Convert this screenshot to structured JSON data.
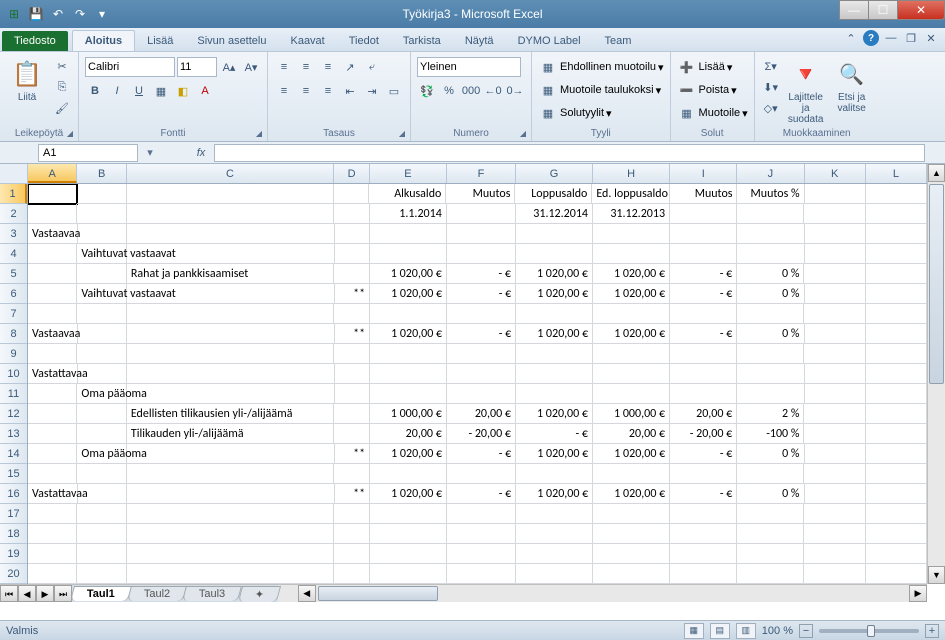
{
  "app": {
    "title": "Työkirja3  -  Microsoft Excel"
  },
  "tabs": {
    "file": "Tiedosto",
    "home": "Aloitus",
    "insert": "Lisää",
    "layout": "Sivun asettelu",
    "formulas": "Kaavat",
    "data": "Tiedot",
    "review": "Tarkista",
    "view": "Näytä",
    "dymo": "DYMO Label",
    "team": "Team"
  },
  "ribbon": {
    "clipboard": {
      "label": "Leikepöytä",
      "paste": "Liitä"
    },
    "font": {
      "label": "Fontti",
      "name": "Calibri",
      "size": "11"
    },
    "alignment": {
      "label": "Tasaus"
    },
    "number": {
      "label": "Numero",
      "format": "Yleinen"
    },
    "styles": {
      "label": "Tyyli",
      "cond": "Ehdollinen muotoilu",
      "table": "Muotoile taulukoksi",
      "cell": "Solutyylit"
    },
    "cells": {
      "label": "Solut",
      "insert": "Lisää",
      "delete": "Poista",
      "format": "Muotoile"
    },
    "editing": {
      "label": "Muokkaaminen",
      "sort": "Lajittele ja suodata",
      "find": "Etsi ja valitse"
    }
  },
  "namebox": "A1",
  "columns": [
    "A",
    "B",
    "C",
    "D",
    "E",
    "F",
    "G",
    "H",
    "I",
    "J",
    "K",
    "L"
  ],
  "colw": [
    "cA",
    "cB",
    "cC",
    "cD",
    "cE",
    "cF",
    "cG",
    "cH",
    "cI",
    "cJ",
    "cK",
    "cL"
  ],
  "rows": [
    {
      "n": 1,
      "cells": [
        "",
        "",
        "",
        "",
        "Alkusaldo",
        "Muutos",
        "Loppusaldo",
        "Ed. loppusaldo",
        "Muutos",
        "Muutos %",
        "",
        ""
      ]
    },
    {
      "n": 2,
      "cells": [
        "",
        "",
        "",
        "",
        "1.1.2014",
        "",
        "31.12.2014",
        "31.12.2013",
        "",
        "",
        "",
        ""
      ]
    },
    {
      "n": 3,
      "cells": [
        "Vastaavaa",
        "",
        "",
        "",
        "",
        "",
        "",
        "",
        "",
        "",
        "",
        ""
      ]
    },
    {
      "n": 4,
      "cells": [
        "",
        "Vaihtuvat vastaavat",
        "",
        "",
        "",
        "",
        "",
        "",
        "",
        "",
        "",
        ""
      ]
    },
    {
      "n": 5,
      "cells": [
        "",
        "",
        "Rahat ja pankkisaamiset",
        "",
        "1 020,00 €",
        "-    €",
        "1 020,00 €",
        "1 020,00 €",
        "-    €",
        "0 %",
        "",
        ""
      ]
    },
    {
      "n": 6,
      "cells": [
        "",
        "Vaihtuvat vastaavat",
        "",
        "**",
        "1 020,00 €",
        "-    €",
        "1 020,00 €",
        "1 020,00 €",
        "-    €",
        "0 %",
        "",
        ""
      ]
    },
    {
      "n": 7,
      "cells": [
        "",
        "",
        "",
        "",
        "",
        "",
        "",
        "",
        "",
        "",
        "",
        ""
      ]
    },
    {
      "n": 8,
      "cells": [
        "Vastaavaa",
        "",
        "",
        "**",
        "1 020,00 €",
        "-    €",
        "1 020,00 €",
        "1 020,00 €",
        "-    €",
        "0 %",
        "",
        ""
      ]
    },
    {
      "n": 9,
      "cells": [
        "",
        "",
        "",
        "",
        "",
        "",
        "",
        "",
        "",
        "",
        "",
        ""
      ]
    },
    {
      "n": 10,
      "cells": [
        "Vastattavaa",
        "",
        "",
        "",
        "",
        "",
        "",
        "",
        "",
        "",
        "",
        ""
      ]
    },
    {
      "n": 11,
      "cells": [
        "",
        "Oma pääoma",
        "",
        "",
        "",
        "",
        "",
        "",
        "",
        "",
        "",
        ""
      ]
    },
    {
      "n": 12,
      "cells": [
        "",
        "",
        "Edellisten tilikausien yli-/alijäämä",
        "",
        "1 000,00 €",
        "20,00 €",
        "1 020,00 €",
        "1 000,00 €",
        "20,00 €",
        "2 %",
        "",
        ""
      ]
    },
    {
      "n": 13,
      "cells": [
        "",
        "",
        "Tilikauden yli-/alijäämä",
        "",
        "20,00 €",
        "- 20,00 €",
        "-    €",
        "20,00 €",
        "- 20,00 €",
        "-100 %",
        "",
        ""
      ]
    },
    {
      "n": 14,
      "cells": [
        "",
        "Oma pääoma",
        "",
        "**",
        "1 020,00 €",
        "-    €",
        "1 020,00 €",
        "1 020,00 €",
        "-    €",
        "0 %",
        "",
        ""
      ]
    },
    {
      "n": 15,
      "cells": [
        "",
        "",
        "",
        "",
        "",
        "",
        "",
        "",
        "",
        "",
        "",
        ""
      ]
    },
    {
      "n": 16,
      "cells": [
        "Vastattavaa",
        "",
        "",
        "**",
        "1 020,00 €",
        "-    €",
        "1 020,00 €",
        "1 020,00 €",
        "-    €",
        "0 %",
        "",
        ""
      ]
    },
    {
      "n": 17,
      "cells": [
        "",
        "",
        "",
        "",
        "",
        "",
        "",
        "",
        "",
        "",
        "",
        ""
      ]
    },
    {
      "n": 18,
      "cells": [
        "",
        "",
        "",
        "",
        "",
        "",
        "",
        "",
        "",
        "",
        "",
        ""
      ]
    },
    {
      "n": 19,
      "cells": [
        "",
        "",
        "",
        "",
        "",
        "",
        "",
        "",
        "",
        "",
        "",
        ""
      ]
    },
    {
      "n": 20,
      "cells": [
        "",
        "",
        "",
        "",
        "",
        "",
        "",
        "",
        "",
        "",
        "",
        ""
      ]
    }
  ],
  "sheets": [
    "Taul1",
    "Taul2",
    "Taul3"
  ],
  "status": {
    "ready": "Valmis",
    "zoom": "100 %"
  }
}
